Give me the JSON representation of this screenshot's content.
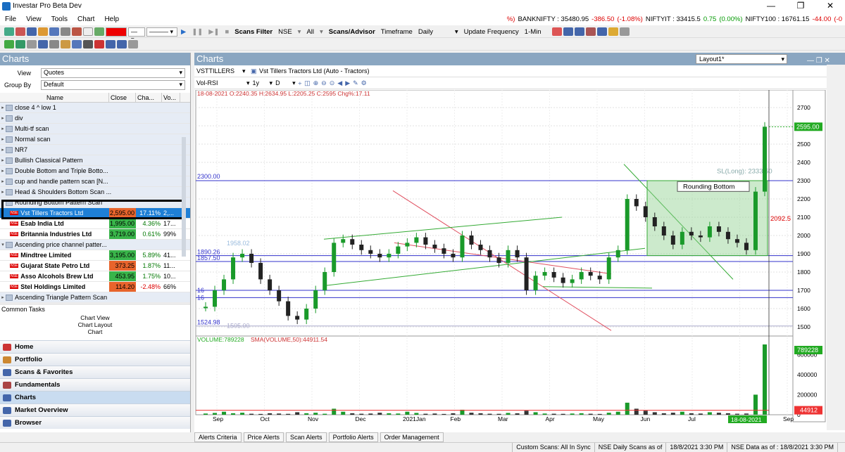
{
  "app": {
    "title": "Investar Pro Beta Dev",
    "menu": [
      "File",
      "View",
      "Tools",
      "Chart",
      "Help"
    ]
  },
  "ticker": [
    {
      "text": "%)",
      "cls": "neg"
    },
    {
      "text": "BANKNIFTY : 35480.95",
      "cls": ""
    },
    {
      "text": "-386.50",
      "cls": "neg"
    },
    {
      "text": "(-1.08%)",
      "cls": "neg"
    },
    {
      "text": "NIFTYIT : 33415.5",
      "cls": ""
    },
    {
      "text": "0.75",
      "cls": "pos"
    },
    {
      "text": "(0.00%)",
      "cls": "pos"
    },
    {
      "text": "NIFTY100 : 16761.15",
      "cls": ""
    },
    {
      "text": "-44.00",
      "cls": "neg"
    },
    {
      "text": "(-0",
      "cls": "neg"
    }
  ],
  "toolbar": {
    "scans_filter": "Scans Filter",
    "exchange": "NSE",
    "all": "All",
    "scans_advisor": "Scans/Advisor",
    "timeframe_label": "Timeframe",
    "timeframe": "Daily",
    "update_label": "Update Frequency",
    "update": "1-Min"
  },
  "left": {
    "title": "Charts",
    "view_label": "View",
    "view_value": "Quotes",
    "group_label": "Group By",
    "group_value": "Default",
    "columns": [
      "Name",
      "Close",
      "Cha...",
      "Vo..."
    ],
    "rows": [
      {
        "g": true,
        "name": "close 4 ^ low 1"
      },
      {
        "g": true,
        "name": "div"
      },
      {
        "g": true,
        "name": "Multi-tf scan"
      },
      {
        "g": true,
        "name": "Normal scan"
      },
      {
        "g": true,
        "name": "NR7"
      },
      {
        "g": true,
        "name": "Bullish Classical Pattern"
      },
      {
        "g": true,
        "name": "Double Bottom and Triple Botto..."
      },
      {
        "g": true,
        "name": "cup and handle pattern scan [N..."
      },
      {
        "g": true,
        "name": "Head & Shoulders Bottom Scan ..."
      },
      {
        "g": true,
        "open": true,
        "name": "Rounding Bottom Pattern Scan"
      },
      {
        "g": false,
        "sel": true,
        "name": "Vst Tillers Tractors Ltd",
        "close": "2,595.00",
        "chg": "17.11%",
        "vol": "2,...",
        "cbg": "#e8642c"
      },
      {
        "g": false,
        "name": "Esab India Ltd",
        "close": "1,995.00",
        "chg": "4.36%",
        "vol": "17...",
        "cbg": "#39b54a"
      },
      {
        "g": false,
        "name": "Britannia Industries Ltd",
        "close": "3,719.00",
        "chg": "0.61%",
        "vol": "99%",
        "cbg": "#39b54a"
      },
      {
        "g": true,
        "open": true,
        "name": "Ascending price channel patter..."
      },
      {
        "g": false,
        "name": "Mindtree Limited",
        "close": "3,195.00",
        "chg": "5.89%",
        "vol": "41...",
        "cbg": "#39b54a"
      },
      {
        "g": false,
        "name": "Gujarat State Petro Ltd",
        "close": "373.25",
        "chg": "1.87%",
        "vol": "11...",
        "cbg": "#e8642c"
      },
      {
        "g": false,
        "name": "Asso Alcohols  Brew Ltd",
        "close": "453.95",
        "chg": "1.75%",
        "vol": "10...",
        "cbg": "#39b54a"
      },
      {
        "g": false,
        "name": "Stel Holdings Limited",
        "close": "114.20",
        "chg": "-2.48%",
        "vol": "66%",
        "cbg": "#e8642c"
      },
      {
        "g": true,
        "name": "Ascending Triangle Pattern Scan"
      }
    ],
    "common_tasks": "Common Tasks",
    "tasks": [
      "Chart View",
      "Chart Layout",
      "Chart"
    ],
    "nav": [
      "Home",
      "Portfolio",
      "Scans & Favorites",
      "Fundamentals",
      "Charts",
      "Market Overview",
      "Browser"
    ]
  },
  "chart": {
    "panel_title": "Charts",
    "layout": "Layout1*",
    "symbol": "VSTTILLERS",
    "company": "Vst Tillers Tractors Ltd  (Auto - Tractors)",
    "template": "Vol-RSI",
    "period": "1y",
    "interval": "D",
    "ohlc": "18-08-2021 O:2240.35 H:2634.95 L:2205.25 C:2595 Chg%:17.11",
    "hlines": [
      "2300.00",
      "1890.26",
      "1857.50",
      "1958.02",
      "1524.98",
      "1505.00",
      "16",
      "16"
    ],
    "sl_text": "SL(Long): 2333.50",
    "rb_label": "Rounding Bottom",
    "target_text": "2092.5",
    "last_price": "2595.00",
    "vol_label": "VOLUME:789228",
    "sma_label": "SMA(VOLUME,50):44911.54",
    "vol_last": "789228",
    "sma_last": "44912",
    "date_badge": "18-08-2021"
  },
  "chart_data": {
    "type": "candlestick",
    "yticks": [
      1500,
      1600,
      1700,
      1800,
      1900,
      2000,
      2100,
      2200,
      2300,
      2400,
      2500,
      2600,
      2700
    ],
    "ylim": [
      1450,
      2750
    ],
    "vol_ticks": [
      0,
      200000,
      400000,
      600000
    ],
    "xticks": [
      "Sep",
      "Oct",
      "Nov",
      "Dec",
      "2021Jan",
      "Feb",
      "Mar",
      "Apr",
      "May",
      "Jun",
      "Jul",
      "Aug",
      "Sep"
    ],
    "close_path": [
      1610,
      1700,
      1760,
      1880,
      1900,
      1850,
      1760,
      1700,
      1640,
      1560,
      1540,
      1600,
      1700,
      1800,
      1960,
      1980,
      1950,
      1920,
      1900,
      1880,
      1900,
      1940,
      1960,
      1990,
      1950,
      1930,
      1900,
      1880,
      2000,
      1950,
      1920,
      1880,
      1850,
      1920,
      1880,
      1700,
      1780,
      1800,
      1770,
      1740,
      1760,
      1800,
      1780,
      1760,
      1880,
      1920,
      2200,
      2160,
      2100,
      2050,
      2000,
      1950,
      2020,
      2000,
      1990,
      2050,
      2020,
      1980,
      1960,
      1920,
      2240,
      2595
    ],
    "volume_path": [
      12000,
      18000,
      30000,
      15000,
      20000,
      10000,
      8000,
      15000,
      12000,
      9000,
      25000,
      15000,
      20000,
      10000,
      60000,
      30000,
      15000,
      10000,
      12000,
      20000,
      15000,
      12000,
      30000,
      18000,
      10000,
      12000,
      8000,
      15000,
      50000,
      20000,
      15000,
      10000,
      9000,
      18000,
      14000,
      40000,
      25000,
      12000,
      10000,
      9000,
      12000,
      15000,
      10000,
      8000,
      20000,
      30000,
      120000,
      60000,
      40000,
      25000,
      15000,
      20000,
      30000,
      15000,
      12000,
      25000,
      20000,
      15000,
      10000,
      12000,
      200000,
      789228
    ],
    "sma_volume": 44911.54
  },
  "tabs": [
    "Alerts Criteria",
    "Price Alerts",
    "Scan Alerts",
    "Portfolio Alerts",
    "Order Management"
  ],
  "status": [
    "Custom Scans: All In Sync",
    "NSE Daily Scans as of",
    "18/8/2021 3:30 PM",
    "NSE Data as of : 18/8/2021 3:30 PM",
    ""
  ]
}
